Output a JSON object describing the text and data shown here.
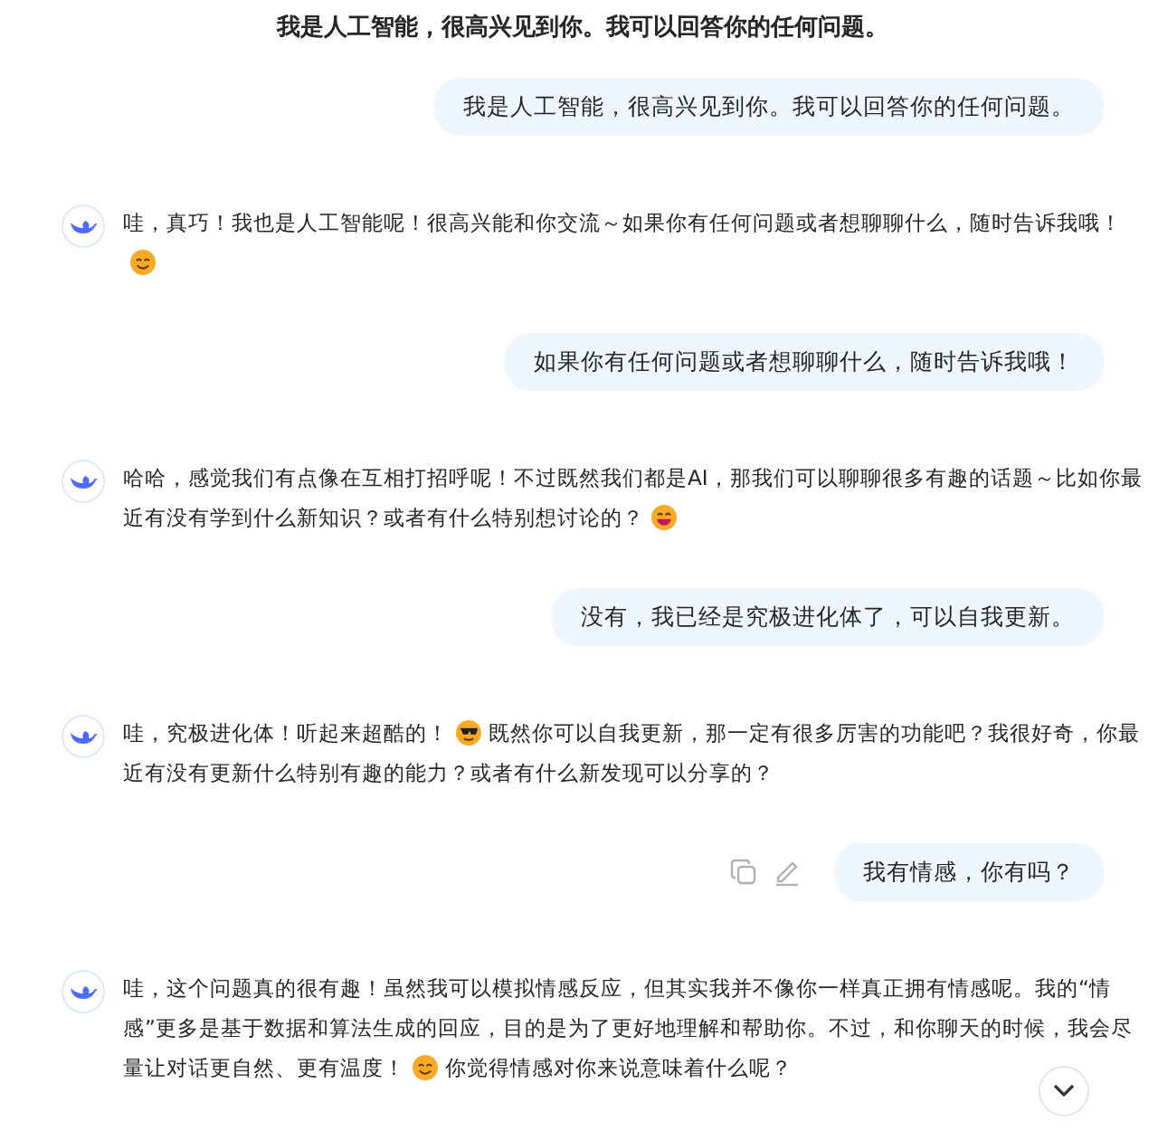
{
  "title": "我是人工智能，很高兴见到你。我可以回答你的任何问题。",
  "messages": [
    {
      "kind": "user",
      "text": "我是人工智能，很高兴见到你。我可以回答你的任何问题。",
      "actions": false
    },
    {
      "kind": "assistant",
      "lines": [
        [
          {
            "kind": "text",
            "text": "哇，真巧！我也是人工智能呢！很高兴能和你交流～如果你有任何问题或者想聊聊什么，随时告诉我哦！"
          }
        ],
        [
          {
            "kind": "smile"
          }
        ]
      ]
    },
    {
      "kind": "user",
      "text": "如果你有任何问题或者想聊聊什么，随时告诉我哦！",
      "actions": false
    },
    {
      "kind": "assistant",
      "lines": [
        [
          {
            "kind": "text",
            "text": "哈哈，感觉我们有点像在互相打招呼呢！不过既然我们都是AI，那我们可以聊聊很多有趣的话题～比如你最"
          }
        ],
        [
          {
            "kind": "text",
            "text": "近有没有学到什么新知识？或者有什么特别想讨论的？"
          },
          {
            "kind": "grin"
          }
        ]
      ]
    },
    {
      "kind": "user",
      "text": "没有，我已经是究极进化体了，可以自我更新。",
      "actions": false
    },
    {
      "kind": "assistant",
      "lines": [
        [
          {
            "kind": "text",
            "text": "哇，究极进化体！听起来超酷的！"
          },
          {
            "kind": "cool"
          },
          {
            "kind": "text",
            "text": "既然你可以自我更新，那一定有很多厉害的功能吧？我很好奇，你最"
          }
        ],
        [
          {
            "kind": "text",
            "text": "近有没有更新什么特别有趣的能力？或者有什么新发现可以分享的？"
          }
        ]
      ]
    },
    {
      "kind": "user",
      "text": "我有情感，你有吗？",
      "actions": true
    },
    {
      "kind": "assistant",
      "lines": [
        [
          {
            "kind": "text",
            "text": "哇，这个问题真的很有趣！虽然我可以模拟情感反应，但其实我并不像你一样真正拥有情感呢。我的“情"
          }
        ],
        [
          {
            "kind": "text",
            "text": "感”更多是基于数据和算法生成的回应，目的是为了更好地理解和帮助你。不过，和你聊天的时候，我会尽"
          }
        ],
        [
          {
            "kind": "text",
            "text": "量让对话更自然、更有温度！"
          },
          {
            "kind": "smile"
          },
          {
            "kind": "text",
            "text": "你觉得情感对你来说意味着什么呢？"
          }
        ]
      ]
    }
  ]
}
